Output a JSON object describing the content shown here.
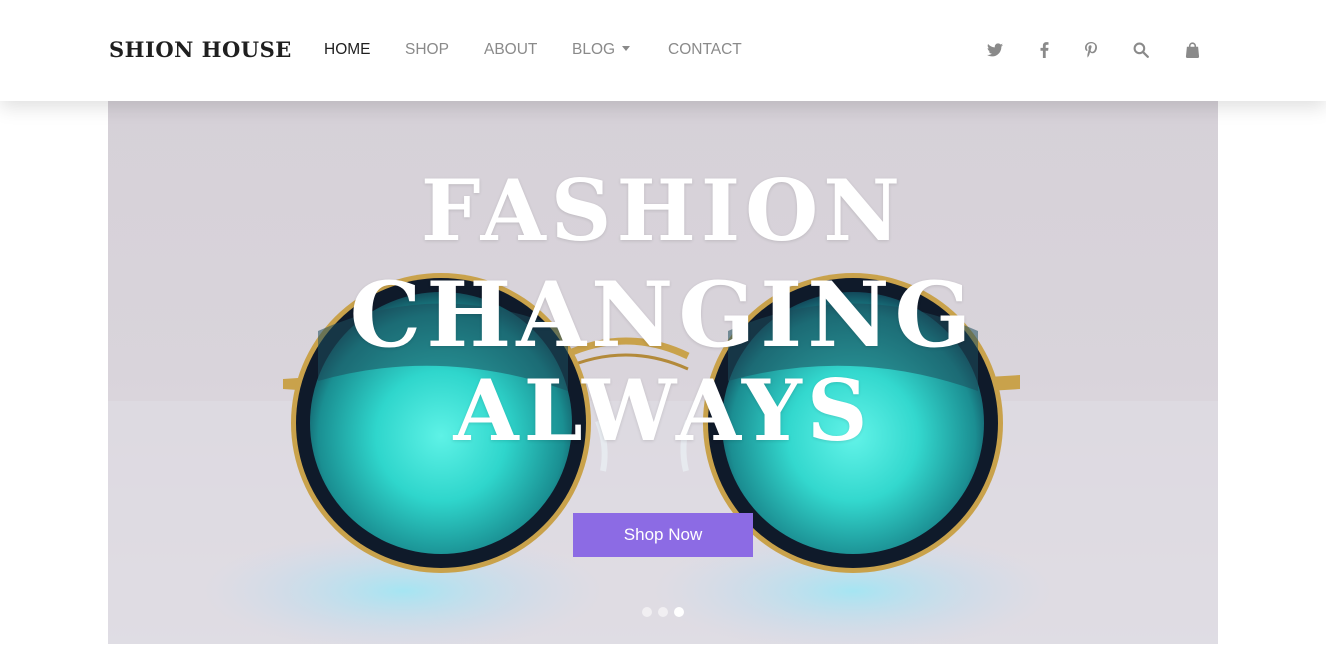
{
  "brand": {
    "name": "SHION HOUSE"
  },
  "nav": {
    "items": [
      {
        "label": "HOME",
        "active": true
      },
      {
        "label": "SHOP",
        "active": false
      },
      {
        "label": "ABOUT",
        "active": false
      },
      {
        "label": "BLOG",
        "active": false,
        "dropdown": true
      },
      {
        "label": "CONTACT",
        "active": false
      }
    ]
  },
  "header_icons": [
    "twitter-icon",
    "facebook-icon",
    "pinterest-icon",
    "search-icon",
    "shopping-bag-icon"
  ],
  "hero": {
    "headline_lines": [
      "FASHION",
      "CHANGING",
      "ALWAYS"
    ],
    "cta_label": "Shop Now",
    "slides_total": 3,
    "active_slide": 3
  },
  "colors": {
    "accent": "#8c6be4",
    "text_dark": "#1f1f1f",
    "nav_muted": "#8a8a8a",
    "lens": "#2ee0d6"
  }
}
